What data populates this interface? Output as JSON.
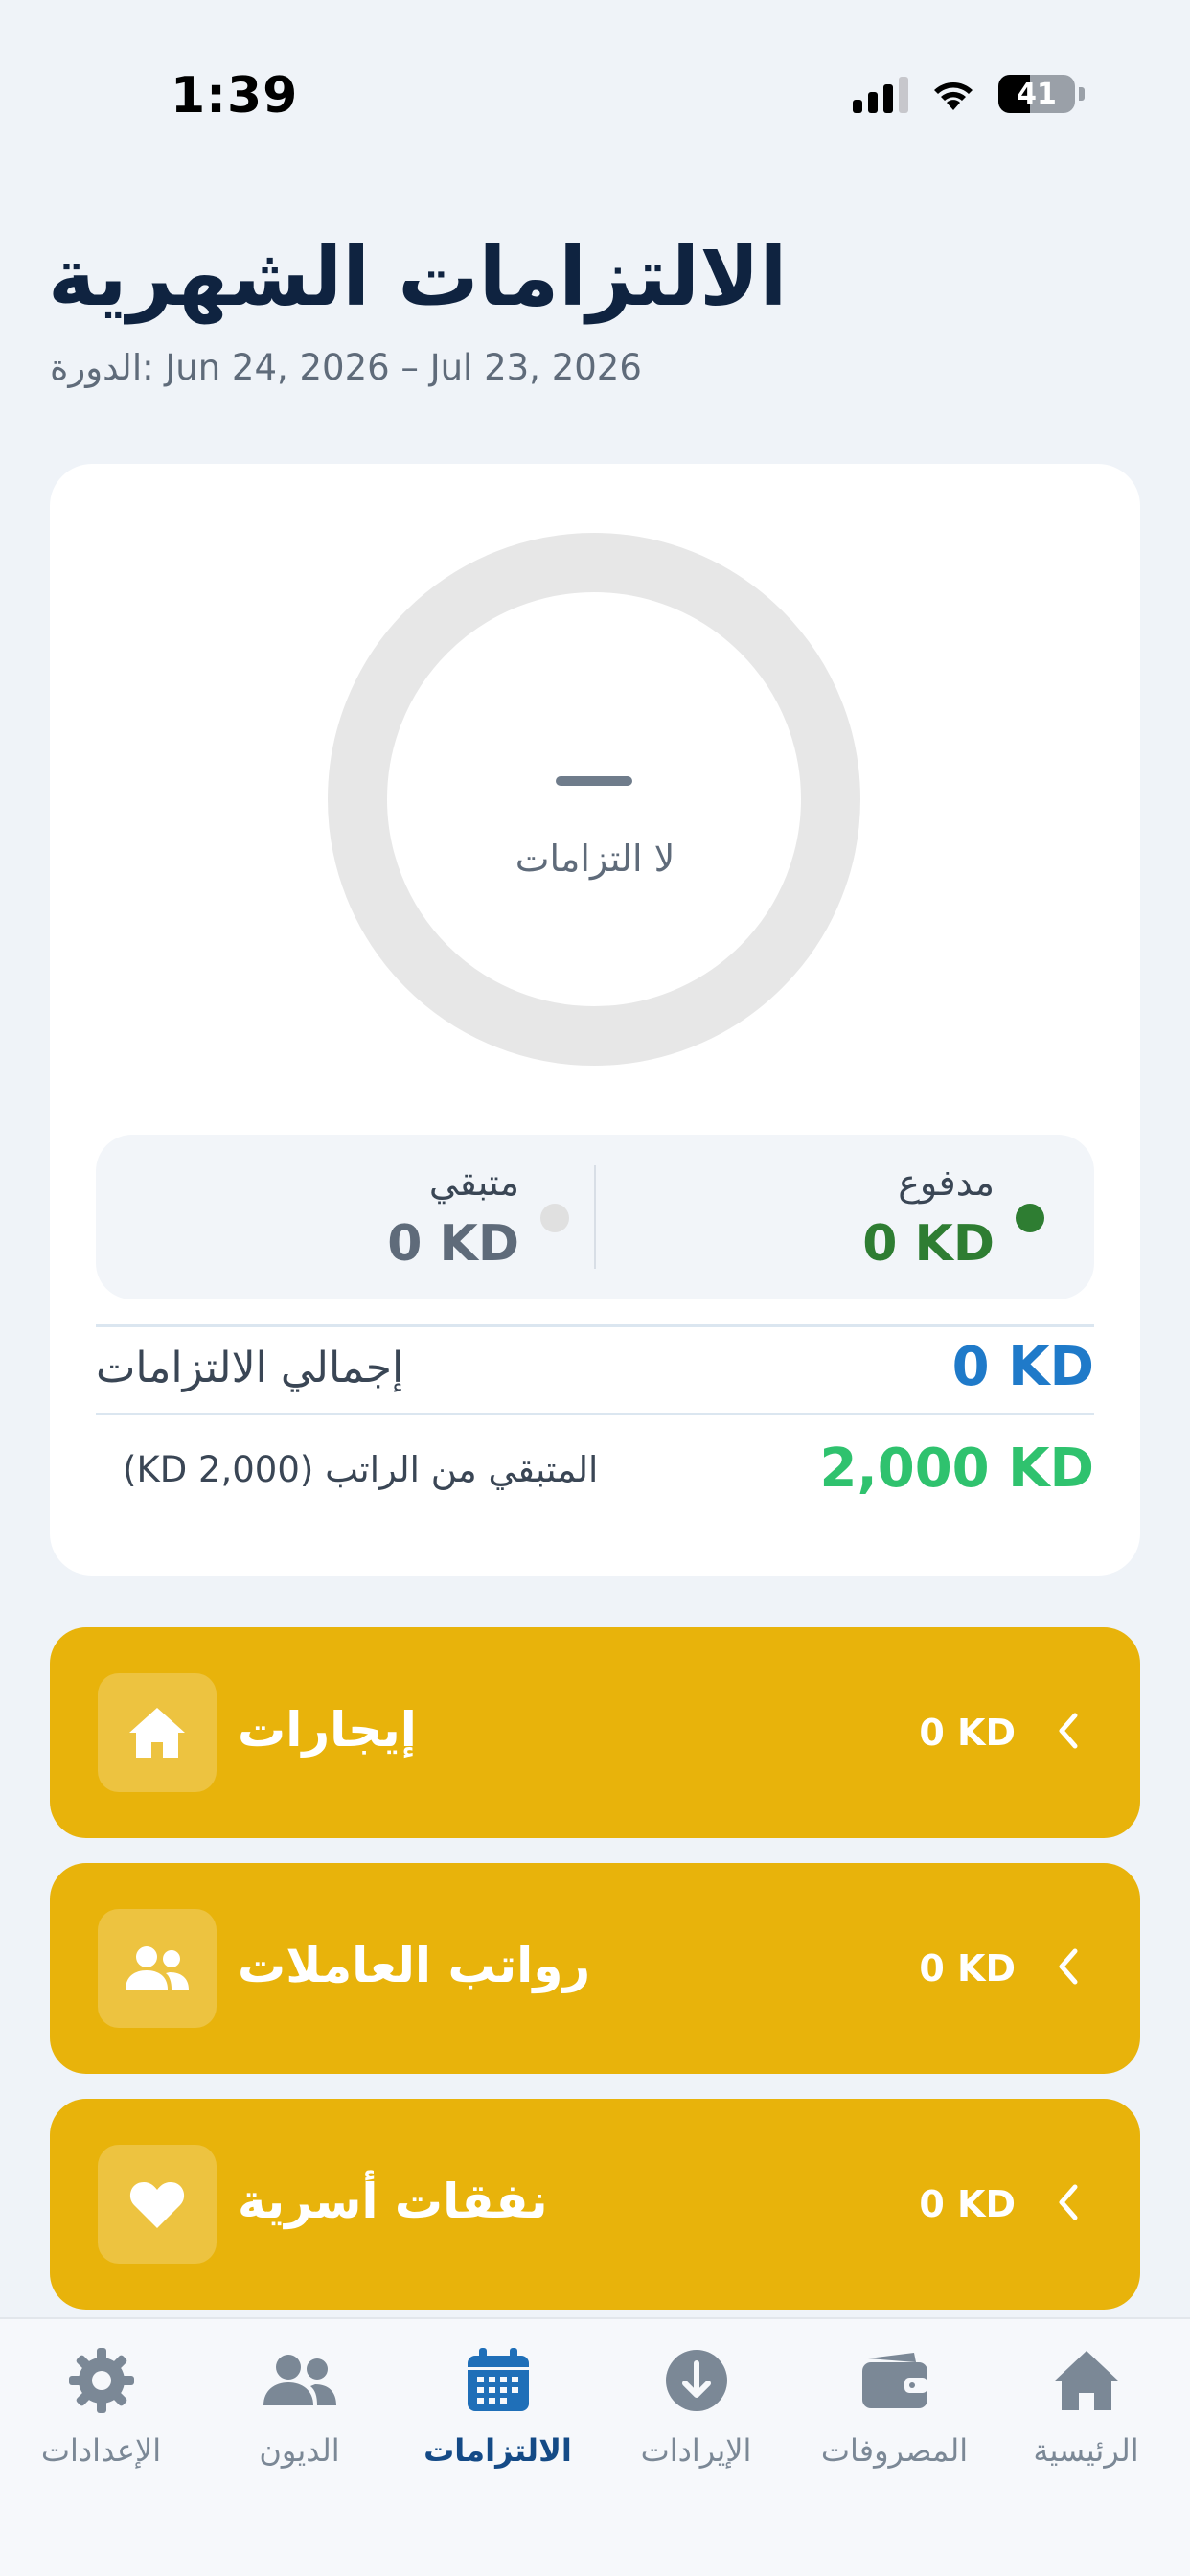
{
  "status_bar": {
    "time": "1:39",
    "battery": "41"
  },
  "header": {
    "title": "الالتزامات الشهرية",
    "cycle": "الدورة: Jun 24, 2026 – Jul 23, 2026"
  },
  "summary": {
    "donut_placeholder": "—",
    "donut_label": "لا التزامات",
    "paid_label": "مدفوع",
    "paid_value": "0 KD",
    "remaining_label": "متبقي",
    "remaining_value": "0 KD",
    "total_label": "إجمالي الالتزامات",
    "total_value": "0 KD",
    "salary_remaining_label": "المتبقي من الراتب (KD 2,000)",
    "salary_remaining_value": "2,000 KD"
  },
  "categories": [
    {
      "title": "إيجارات",
      "amount": "0 KD",
      "icon": "home-icon"
    },
    {
      "title": "رواتب العاملات",
      "amount": "0 KD",
      "icon": "people-icon"
    },
    {
      "title": "نفقات أسرية",
      "amount": "0 KD",
      "icon": "heart-icon"
    }
  ],
  "tabs": [
    {
      "label": "الإعدادات",
      "icon": "gear-icon"
    },
    {
      "label": "الديون",
      "icon": "people-icon"
    },
    {
      "label": "الالتزامات",
      "icon": "calendar-icon",
      "active": true
    },
    {
      "label": "الإيرادات",
      "icon": "download-icon"
    },
    {
      "label": "المصروفات",
      "icon": "wallet-icon"
    },
    {
      "label": "الرئيسية",
      "icon": "home-icon"
    }
  ],
  "colors": {
    "category_bg": "#e8b30b",
    "paid": "#2e7d32",
    "total": "#1f7ac9",
    "salary": "#2fc26e",
    "tab_active": "#144a86"
  }
}
